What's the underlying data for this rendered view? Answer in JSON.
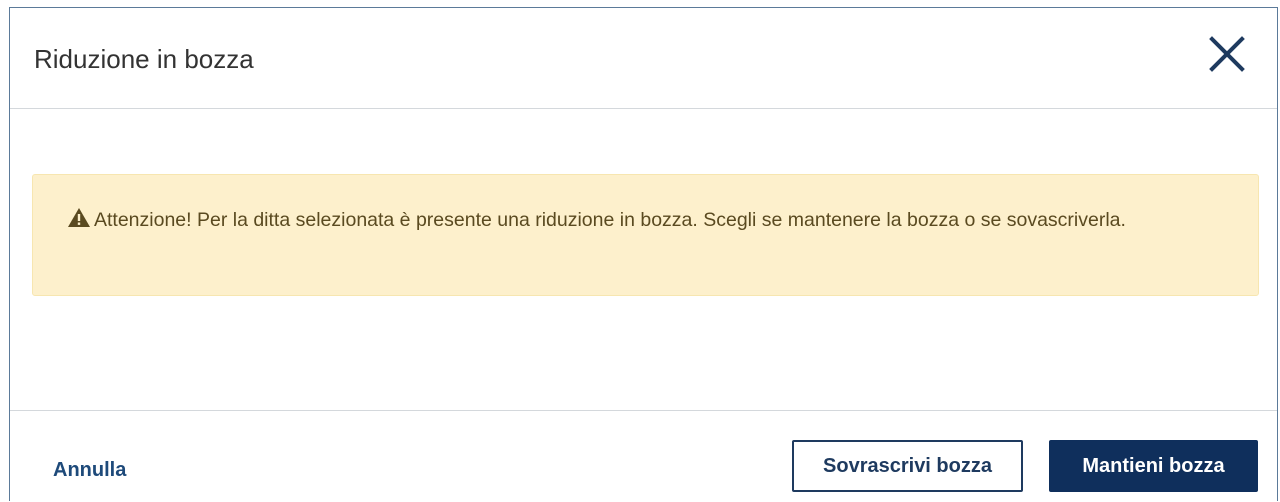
{
  "dialog": {
    "title": "Riduzione in bozza",
    "close_icon": "close-icon"
  },
  "alert": {
    "icon": "warning-triangle-icon",
    "message": "Attenzione! Per la ditta selezionata è presente una riduzione in bozza. Scegli se mantenere la bozza o se sovascriverla.",
    "background_color": "#fdf0cc"
  },
  "footer": {
    "cancel_label": "Annulla",
    "overwrite_label": "Sovrascrivi bozza",
    "keep_label": "Mantieni bozza"
  },
  "colors": {
    "primary": "#0f2f5c",
    "link": "#1e4a7a"
  }
}
